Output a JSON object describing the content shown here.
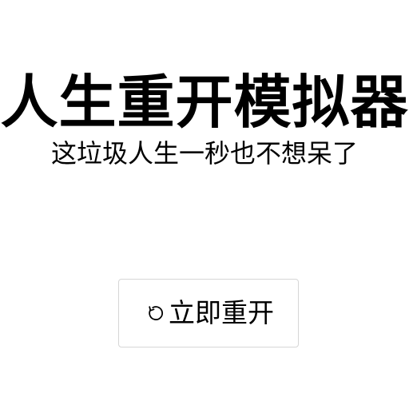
{
  "header": {
    "title": "人生重开模拟器",
    "subtitle": "这垃圾人生一秒也不想呆了"
  },
  "actions": {
    "restart_label": "立即重开",
    "restart_icon": "refresh-icon"
  },
  "colors": {
    "background": "#ffffff",
    "text": "#000000",
    "button_border": "#d6d6d6"
  }
}
